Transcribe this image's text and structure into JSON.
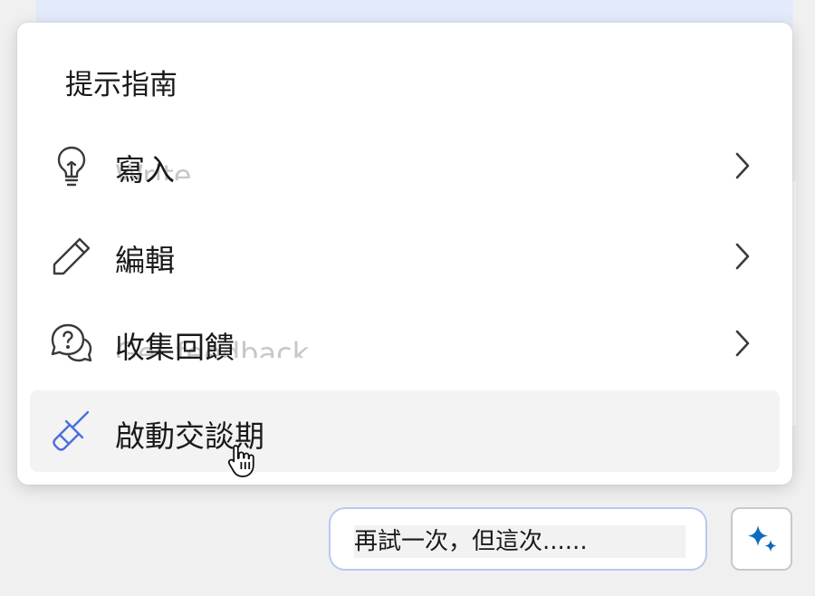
{
  "menu": {
    "title": "提示指南",
    "items": [
      {
        "label": "寫入",
        "ghost": "Write",
        "icon": "lightbulb-icon",
        "has_submenu": true
      },
      {
        "label": "編輯",
        "ghost": "",
        "icon": "pencil-icon",
        "has_submenu": true
      },
      {
        "label": "收集回饋",
        "ghost": "Get feedback",
        "icon": "chat-question-icon",
        "has_submenu": true
      },
      {
        "label": "啟動交談期",
        "ghost": "",
        "icon": "broom-icon",
        "has_submenu": false
      }
    ]
  },
  "suggestion": {
    "text": "再試一次，但這次......"
  },
  "colors": {
    "accent": "#0f6cbd",
    "broom": "#4a6fdc",
    "pill_border": "#b8c9f0",
    "hover_bg": "#f3f3f3"
  }
}
